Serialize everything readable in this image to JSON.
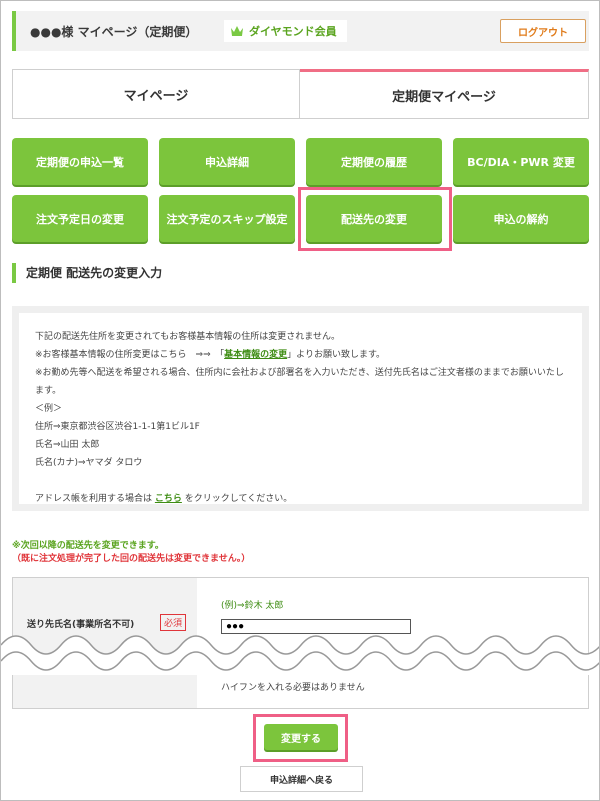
{
  "header": {
    "title": "●●●様 マイページ（定期便）",
    "badge": "ダイヤモンド会員",
    "logout": "ログアウト"
  },
  "tabs": [
    {
      "label": "マイページ",
      "active": false
    },
    {
      "label": "定期便マイページ",
      "active": true
    }
  ],
  "menu_buttons": [
    "定期便の申込一覧",
    "申込詳細",
    "定期便の履歴",
    "BC/DIA・PWR 変更",
    "注文予定日の変更",
    "注文予定のスキップ設定",
    "配送先の変更",
    "申込の解約"
  ],
  "section_title": "定期便 配送先の変更入力",
  "info": {
    "line1": "下記の配送先住所を変更されてもお客様基本情報の住所は変更されません。",
    "line2_pre": "※お客様基本情報の住所変更はこちら　⇒⇒　「",
    "line2_link": "基本情報の変更",
    "line2_post": "」よりお願い致します。",
    "line3": "※お勤め先等へ配送を希望される場合、住所内に会社および部署名を入力いただき、送付先氏名はご注文者様のままでお願いいたします。",
    "line4": "＜例＞",
    "line5": "住所⇒東京都渋谷区渋谷1-1-1第1ビル1F",
    "line6": "氏名⇒山田 太郎",
    "line7": "氏名(カナ)⇒ヤマダ タロウ",
    "line8_pre": "アドレス帳を利用する場合は ",
    "line8_link": "こちら",
    "line8_post": " をクリックしてください。"
  },
  "notes": {
    "green": "※次回以降の配送先を変更できます。",
    "red": "（既に注文処理が完了した回の配送先は変更できません。）"
  },
  "form": {
    "label": "送り先氏名(事業所名不可)",
    "required": "必須",
    "example": "(例)⇒鈴木 太郎",
    "value": "●●●",
    "helper": "ハイフンを入れる必要はありません"
  },
  "actions": {
    "submit": "変更する",
    "back": "申込詳細へ戻る"
  },
  "colors": {
    "accent_green": "#7cc53c",
    "highlight_pink": "#ef5f86",
    "required_red": "#e0353a"
  }
}
